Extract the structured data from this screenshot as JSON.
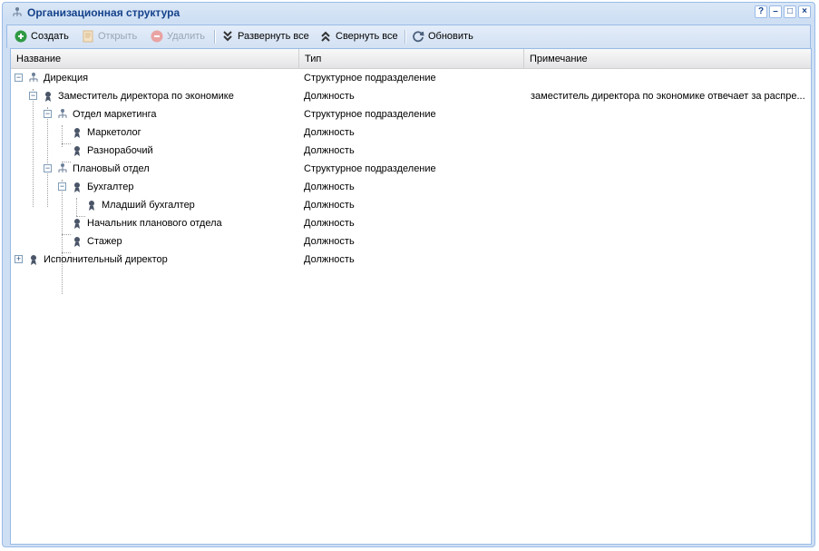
{
  "window": {
    "title": "Организационная структура"
  },
  "title_tools": [
    "?",
    "–",
    "□",
    "×"
  ],
  "toolbar": {
    "create": "Создать",
    "open": "Открыть",
    "delete": "Удалить",
    "expand_all": "Развернуть все",
    "collapse_all": "Свернуть все",
    "refresh": "Обновить"
  },
  "grid": {
    "columns": [
      "Название",
      "Тип",
      "Примечание"
    ],
    "rows": [
      {
        "name": "Дирекция",
        "type": "Структурное подразделение",
        "note": ""
      },
      {
        "name": "Заместитель директора по экономике",
        "type": "Должность",
        "note": "заместитель директора по экономике отвечает за распре..."
      },
      {
        "name": "Отдел маркетинга",
        "type": "Структурное подразделение",
        "note": ""
      },
      {
        "name": "Маркетолог",
        "type": "Должность",
        "note": ""
      },
      {
        "name": "Разнорабочий",
        "type": "Должность",
        "note": ""
      },
      {
        "name": "Плановый отдел",
        "type": "Структурное подразделение",
        "note": ""
      },
      {
        "name": "Бухгалтер",
        "type": "Должность",
        "note": ""
      },
      {
        "name": "Младший бухгалтер",
        "type": "Должность",
        "note": ""
      },
      {
        "name": "Начальник планового отдела",
        "type": "Должность",
        "note": ""
      },
      {
        "name": "Стажер",
        "type": "Должность",
        "note": ""
      },
      {
        "name": "Исполнительный директор",
        "type": "Должность",
        "note": ""
      }
    ]
  }
}
